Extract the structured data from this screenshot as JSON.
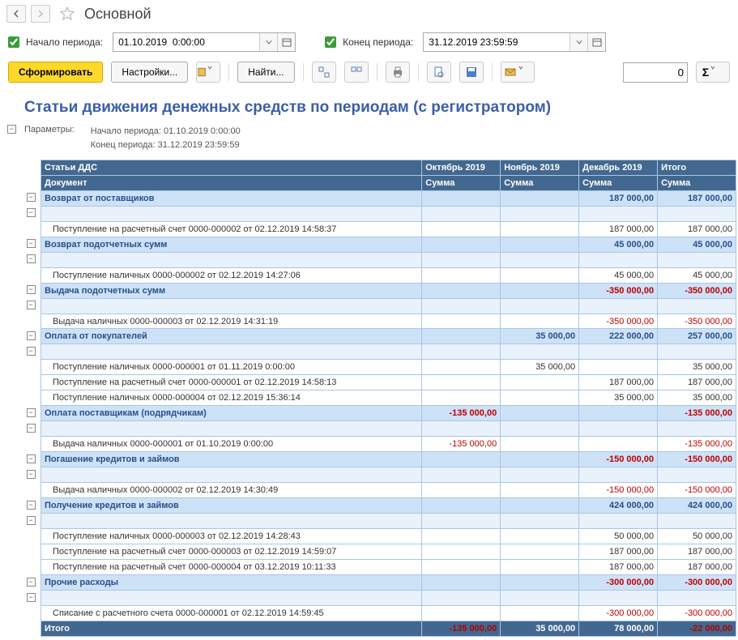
{
  "title": "Основной",
  "period": {
    "start_label": "Начало периода:",
    "start_value": "01.10.2019  0:00:00",
    "end_label": "Конец периода:",
    "end_value": "31.12.2019 23:59:59"
  },
  "toolbar": {
    "generate": "Сформировать",
    "settings": "Настройки...",
    "find": "Найти...",
    "level": "0"
  },
  "report": {
    "title": "Статьи движения денежных средств по периодам (с регистратором)",
    "params_label": "Параметры:",
    "params_lines": [
      "Начало периода: 01.10.2019 0:00:00",
      "Конец периода: 31.12.2019 23:59:59"
    ]
  },
  "headers": {
    "row1": [
      "Статьи ДДС",
      "Октябрь 2019",
      "Ноябрь 2019",
      "Декабрь 2019",
      "Итого"
    ],
    "row2": [
      "Документ",
      "Сумма",
      "Сумма",
      "Сумма",
      "Сумма"
    ]
  },
  "rows": [
    {
      "type": "grp",
      "name": "Возврат от поставщиков",
      "oct": "",
      "nov": "",
      "dec": "187 000,00",
      "tot": "187 000,00"
    },
    {
      "type": "sub",
      "name": "",
      "oct": "",
      "nov": "",
      "dec": "",
      "tot": ""
    },
    {
      "type": "det",
      "name": "Поступление на расчетный счет 0000-000002 от 02.12.2019 14:58:37",
      "oct": "",
      "nov": "",
      "dec": "187 000,00",
      "tot": "187 000,00"
    },
    {
      "type": "grp",
      "name": "Возврат подотчетных сумм",
      "oct": "",
      "nov": "",
      "dec": "45 000,00",
      "tot": "45 000,00"
    },
    {
      "type": "sub",
      "name": "",
      "oct": "",
      "nov": "",
      "dec": "",
      "tot": ""
    },
    {
      "type": "det",
      "name": "Поступление наличных 0000-000002 от 02.12.2019 14:27:06",
      "oct": "",
      "nov": "",
      "dec": "45 000,00",
      "tot": "45 000,00"
    },
    {
      "type": "grp",
      "name": "Выдача подотчетных сумм",
      "oct": "",
      "nov": "",
      "dec": "-350 000,00",
      "tot": "-350 000,00",
      "neg": true
    },
    {
      "type": "sub",
      "name": "",
      "oct": "",
      "nov": "",
      "dec": "",
      "tot": ""
    },
    {
      "type": "det",
      "name": "Выдача наличных 0000-000003 от 02.12.2019 14:31:19",
      "oct": "",
      "nov": "",
      "dec": "-350 000,00",
      "tot": "-350 000,00",
      "neg": true
    },
    {
      "type": "grp",
      "name": "Оплата от покупателей",
      "oct": "",
      "nov": "35 000,00",
      "dec": "222 000,00",
      "tot": "257 000,00"
    },
    {
      "type": "sub",
      "name": "",
      "oct": "",
      "nov": "",
      "dec": "",
      "tot": ""
    },
    {
      "type": "det",
      "name": "Поступление наличных 0000-000001 от 01.11.2019 0:00:00",
      "oct": "",
      "nov": "35 000,00",
      "dec": "",
      "tot": "35 000,00"
    },
    {
      "type": "det",
      "name": "Поступление на расчетный счет 0000-000001 от 02.12.2019 14:58:13",
      "oct": "",
      "nov": "",
      "dec": "187 000,00",
      "tot": "187 000,00"
    },
    {
      "type": "det",
      "name": "Поступление наличных 0000-000004 от 02.12.2019 15:36:14",
      "oct": "",
      "nov": "",
      "dec": "35 000,00",
      "tot": "35 000,00"
    },
    {
      "type": "grp",
      "name": "Оплата поставщикам (подрядчикам)",
      "oct": "-135 000,00",
      "nov": "",
      "dec": "",
      "tot": "-135 000,00",
      "neg": true
    },
    {
      "type": "sub",
      "name": "",
      "oct": "",
      "nov": "",
      "dec": "",
      "tot": ""
    },
    {
      "type": "det",
      "name": "Выдача наличных 0000-000001 от 01.10.2019 0:00:00",
      "oct": "-135 000,00",
      "nov": "",
      "dec": "",
      "tot": "-135 000,00",
      "neg": true
    },
    {
      "type": "grp",
      "name": "Погашение кредитов и займов",
      "oct": "",
      "nov": "",
      "dec": "-150 000,00",
      "tot": "-150 000,00",
      "neg": true
    },
    {
      "type": "sub",
      "name": "",
      "oct": "",
      "nov": "",
      "dec": "",
      "tot": ""
    },
    {
      "type": "det",
      "name": "Выдача наличных 0000-000002 от 02.12.2019 14:30:49",
      "oct": "",
      "nov": "",
      "dec": "-150 000,00",
      "tot": "-150 000,00",
      "neg": true
    },
    {
      "type": "grp",
      "name": "Получение кредитов и займов",
      "oct": "",
      "nov": "",
      "dec": "424 000,00",
      "tot": "424 000,00"
    },
    {
      "type": "sub",
      "name": "",
      "oct": "",
      "nov": "",
      "dec": "",
      "tot": ""
    },
    {
      "type": "det",
      "name": "Поступление наличных 0000-000003 от 02.12.2019 14:28:43",
      "oct": "",
      "nov": "",
      "dec": "50 000,00",
      "tot": "50 000,00"
    },
    {
      "type": "det",
      "name": "Поступление на расчетный счет 0000-000003 от 02.12.2019 14:59:07",
      "oct": "",
      "nov": "",
      "dec": "187 000,00",
      "tot": "187 000,00"
    },
    {
      "type": "det",
      "name": "Поступление на расчетный счет 0000-000004 от 03.12.2019 10:11:33",
      "oct": "",
      "nov": "",
      "dec": "187 000,00",
      "tot": "187 000,00"
    },
    {
      "type": "grp",
      "name": "Прочие расходы",
      "oct": "",
      "nov": "",
      "dec": "-300 000,00",
      "tot": "-300 000,00",
      "neg": true
    },
    {
      "type": "sub",
      "name": "",
      "oct": "",
      "nov": "",
      "dec": "",
      "tot": ""
    },
    {
      "type": "det",
      "name": "Списание с расчетного счета 0000-000001 от 02.12.2019 14:59:45",
      "oct": "",
      "nov": "",
      "dec": "-300 000,00",
      "tot": "-300 000,00",
      "neg": true
    },
    {
      "type": "tot",
      "name": "Итого",
      "oct": "-135 000,00",
      "nov": "35 000,00",
      "dec": "78 000,00",
      "tot": "-22 000,00",
      "octNeg": true,
      "totNeg": true
    }
  ]
}
